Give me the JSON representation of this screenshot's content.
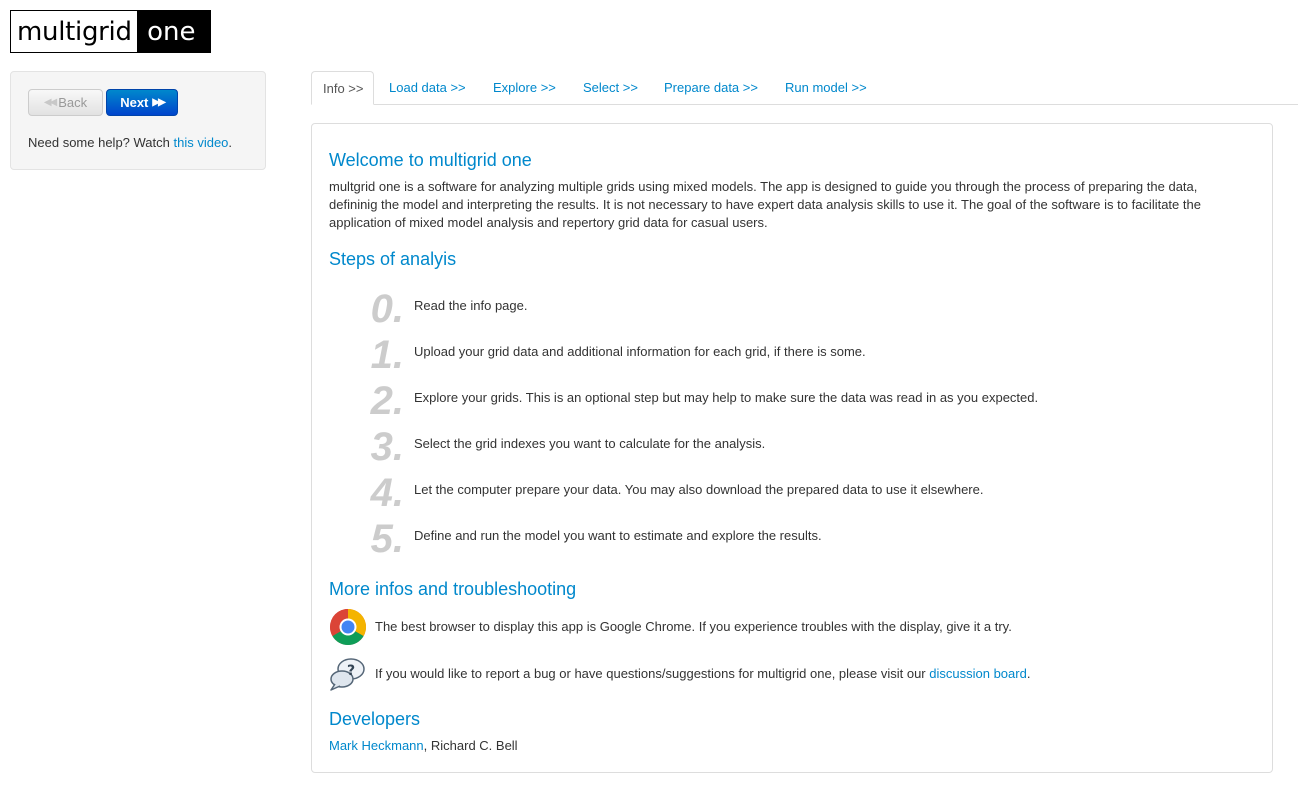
{
  "logo": {
    "part1": "multigrid",
    "part2": "one"
  },
  "sidebar": {
    "back_label": "Back",
    "next_label": "Next",
    "help_text": "Need some help? Watch ",
    "help_link": "this video",
    "help_end": "."
  },
  "tabs": [
    {
      "label": "Info >>"
    },
    {
      "label": "Load data >>"
    },
    {
      "label": "Explore >>"
    },
    {
      "label": "Select >>"
    },
    {
      "label": "Prepare data >>"
    },
    {
      "label": "Run model >>"
    }
  ],
  "main": {
    "welcome_title": "Welcome to multigrid one",
    "welcome_text": "multgrid one is a software for analyzing multiple grids using mixed models. The app is designed to guide you through the process of preparing the data, defininig the model and interpreting the results. It is not necessary to have expert data analysis skills to use it. The goal of the software is to facilitate the application of mixed model analysis and repertory grid data for casual users.",
    "steps_title": "Steps of analyis",
    "steps": [
      {
        "num": "0.",
        "text": "Read the info page."
      },
      {
        "num": "1.",
        "text": "Upload your grid data and additional information for each grid, if there is some."
      },
      {
        "num": "2.",
        "text": "Explore your grids. This is an optional step but may help to make sure the data was read in as you expected."
      },
      {
        "num": "3.",
        "text": "Select the grid indexes you want to calculate for the analysis."
      },
      {
        "num": "4.",
        "text": "Let the computer prepare your data. You may also download the prepared data to use it elsewhere."
      },
      {
        "num": "5.",
        "text": "Define and run the model you want to estimate and explore the results."
      }
    ],
    "more_title": "More infos and troubleshooting",
    "browser_text": "The best browser to display this app is Google Chrome. If you experience troubles with the display, give it a try.",
    "bug_text": "If you would like to report a bug or have questions/suggestions for multigrid one, please visit our ",
    "bug_link": "discussion board",
    "bug_end": ".",
    "dev_title": "Developers",
    "dev1": "Mark Heckmann",
    "dev_sep": ", ",
    "dev2": "Richard C. Bell"
  },
  "colors": {
    "link": "#0088cc",
    "step_number": "#cccccc",
    "next_button": "#0055cc"
  },
  "icons": {
    "browser": "chrome-icon",
    "help": "question-bubbles-icon",
    "back": "double-chevron-left-icon",
    "next": "double-chevron-right-icon"
  }
}
